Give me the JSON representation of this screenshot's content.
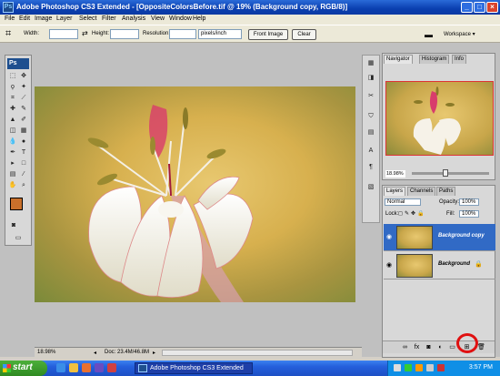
{
  "window": {
    "title": "Adobe Photoshop CS3 Extended - [OppositeColorsBefore.tif @ 19% (Background copy, RGB/8)]",
    "app_icon": "Ps"
  },
  "menu": [
    "File",
    "Edit",
    "Image",
    "Layer",
    "Select",
    "Filter",
    "Analysis",
    "View",
    "Window",
    "Help"
  ],
  "options": {
    "width_label": "Width:",
    "width_value": "",
    "height_label": "Height:",
    "height_value": "",
    "resolution_label": "Resolution:",
    "resolution_value": "",
    "unit": "pixels/inch",
    "front_image": "Front Image",
    "clear": "Clear",
    "workspace": "Workspace ▾"
  },
  "toolbox": {
    "logo": "Ps",
    "foreground_color": "#c8702b",
    "background_color": "#ffffff"
  },
  "document": {
    "zoom": "18.98%",
    "doc_size": "Doc: 23.4M/46.8M"
  },
  "navigator": {
    "tabs": [
      "Navigator",
      "Histogram",
      "Info"
    ],
    "zoom": "18.98%"
  },
  "layers": {
    "tabs": [
      "Layers",
      "Channels",
      "Paths"
    ],
    "blend_mode": "Normal",
    "opacity_label": "Opacity:",
    "opacity": "100%",
    "lock_label": "Lock:",
    "fill_label": "Fill:",
    "fill": "100%",
    "items": [
      {
        "name": "Background copy",
        "selected": true
      },
      {
        "name": "Background",
        "selected": false,
        "locked": true
      }
    ],
    "footer_icons": [
      "link-icon",
      "fx-icon",
      "mask-icon",
      "adjustment-icon",
      "folder-icon",
      "new-layer-icon",
      "trash-icon"
    ]
  },
  "taskbar": {
    "start": "start",
    "task": "Adobe Photoshop CS3 Extended",
    "time": "3:57 PM"
  },
  "colors": {
    "title_blue": "#0a3fb0",
    "selection": "#316ac5",
    "highlight_circle": "#e01010"
  }
}
